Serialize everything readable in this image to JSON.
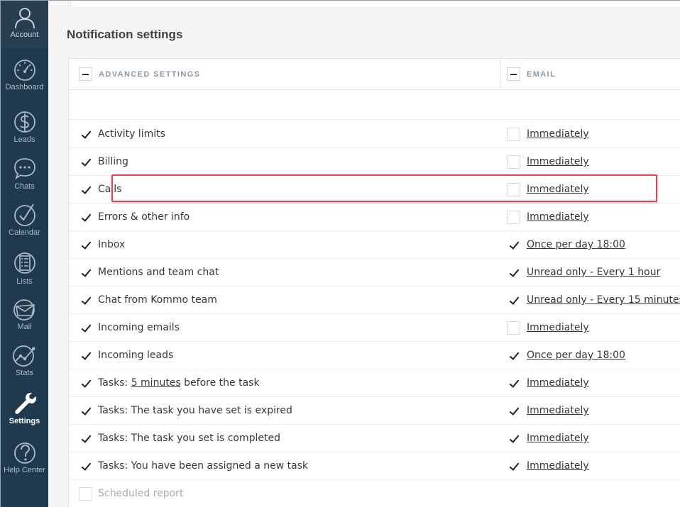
{
  "sidebar": {
    "items": [
      {
        "label": "Account",
        "icon": "account-icon"
      },
      {
        "label": "Dashboard",
        "icon": "dashboard-icon"
      },
      {
        "label": "Leads",
        "icon": "dollar-icon"
      },
      {
        "label": "Chats",
        "icon": "chat-bubble-icon"
      },
      {
        "label": "Calendar",
        "icon": "checkmark-circle-icon"
      },
      {
        "label": "Lists",
        "icon": "list-icon"
      },
      {
        "label": "Mail",
        "icon": "mail-icon"
      },
      {
        "label": "Stats",
        "icon": "stats-icon"
      },
      {
        "label": "Settings",
        "icon": "wrench-icon",
        "active": true
      },
      {
        "label": "Help Center",
        "icon": "help-icon"
      }
    ],
    "colors": {
      "background": "#1f3a4f",
      "text": "#aeb9c2",
      "active": "#ffffff"
    }
  },
  "page": {
    "title": "Notification settings"
  },
  "table": {
    "headers": {
      "left": "ADVANCED SETTINGS",
      "right": "EMAIL"
    },
    "rows": [
      {
        "pre": "Activity limits",
        "link": "",
        "post": "",
        "enabled": true,
        "email_checked": false,
        "frequency": "Immediately"
      },
      {
        "pre": "Billing",
        "link": "",
        "post": "",
        "enabled": true,
        "email_checked": false,
        "frequency": "Immediately"
      },
      {
        "pre": "Calls",
        "link": "",
        "post": "",
        "enabled": true,
        "email_checked": false,
        "frequency": "Immediately"
      },
      {
        "pre": "Errors & other info",
        "link": "",
        "post": "",
        "enabled": true,
        "email_checked": false,
        "frequency": "Immediately"
      },
      {
        "pre": "Inbox",
        "link": "",
        "post": "",
        "enabled": true,
        "email_checked": true,
        "frequency": "Once per day 18:00"
      },
      {
        "pre": "Mentions and team chat",
        "link": "",
        "post": "",
        "enabled": true,
        "email_checked": true,
        "frequency": "Unread only - Every 1 hour"
      },
      {
        "pre": "Chat from Kommo team",
        "link": "",
        "post": "",
        "enabled": true,
        "email_checked": true,
        "frequency": "Unread only - Every 15 minutes"
      },
      {
        "pre": "Incoming emails",
        "link": "",
        "post": "",
        "enabled": true,
        "email_checked": false,
        "frequency": "Immediately"
      },
      {
        "pre": "Incoming leads",
        "link": "",
        "post": "",
        "enabled": true,
        "email_checked": true,
        "frequency": "Once per day 18:00"
      },
      {
        "pre": "Tasks: ",
        "link": "5 minutes",
        "post": " before the task",
        "enabled": true,
        "email_checked": true,
        "frequency": "Immediately"
      },
      {
        "pre": "Tasks: The task you have set is expired",
        "link": "",
        "post": "",
        "enabled": true,
        "email_checked": true,
        "frequency": "Immediately"
      },
      {
        "pre": "Tasks: The task you set is completed",
        "link": "",
        "post": "",
        "enabled": true,
        "email_checked": true,
        "frequency": "Immediately"
      },
      {
        "pre": "Tasks: You have been assigned a new task",
        "link": "",
        "post": "",
        "enabled": true,
        "email_checked": true,
        "frequency": "Immediately"
      },
      {
        "pre": "Scheduled report",
        "link": "",
        "post": "",
        "enabled": false,
        "email_checked": null,
        "frequency": ""
      }
    ]
  },
  "highlight": {
    "row": "Calls",
    "color": "#e8434c"
  }
}
